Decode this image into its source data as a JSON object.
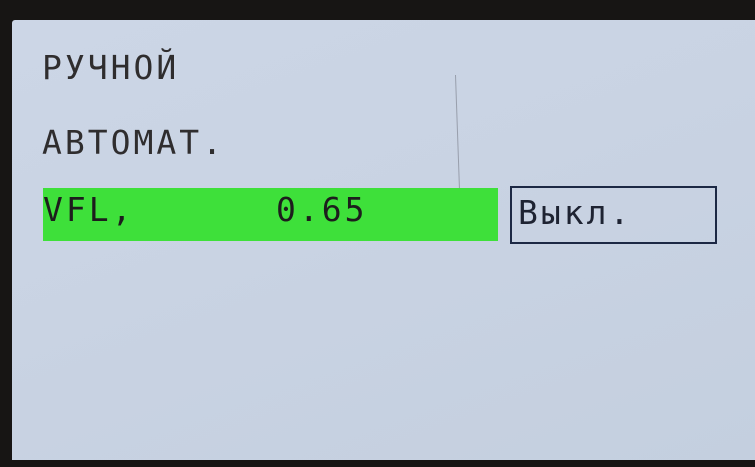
{
  "menu": {
    "items": [
      {
        "label": "РУЧНОЙ"
      },
      {
        "label": "АВТОМАТ."
      }
    ],
    "selected": {
      "label": "VFL,",
      "value": "0.65"
    }
  },
  "status": {
    "label": "Выкл."
  },
  "colors": {
    "screen_bg": "#c9d3e3",
    "highlight": "#3ee03a",
    "text": "#2f2d2e",
    "bezel": "#171514"
  }
}
